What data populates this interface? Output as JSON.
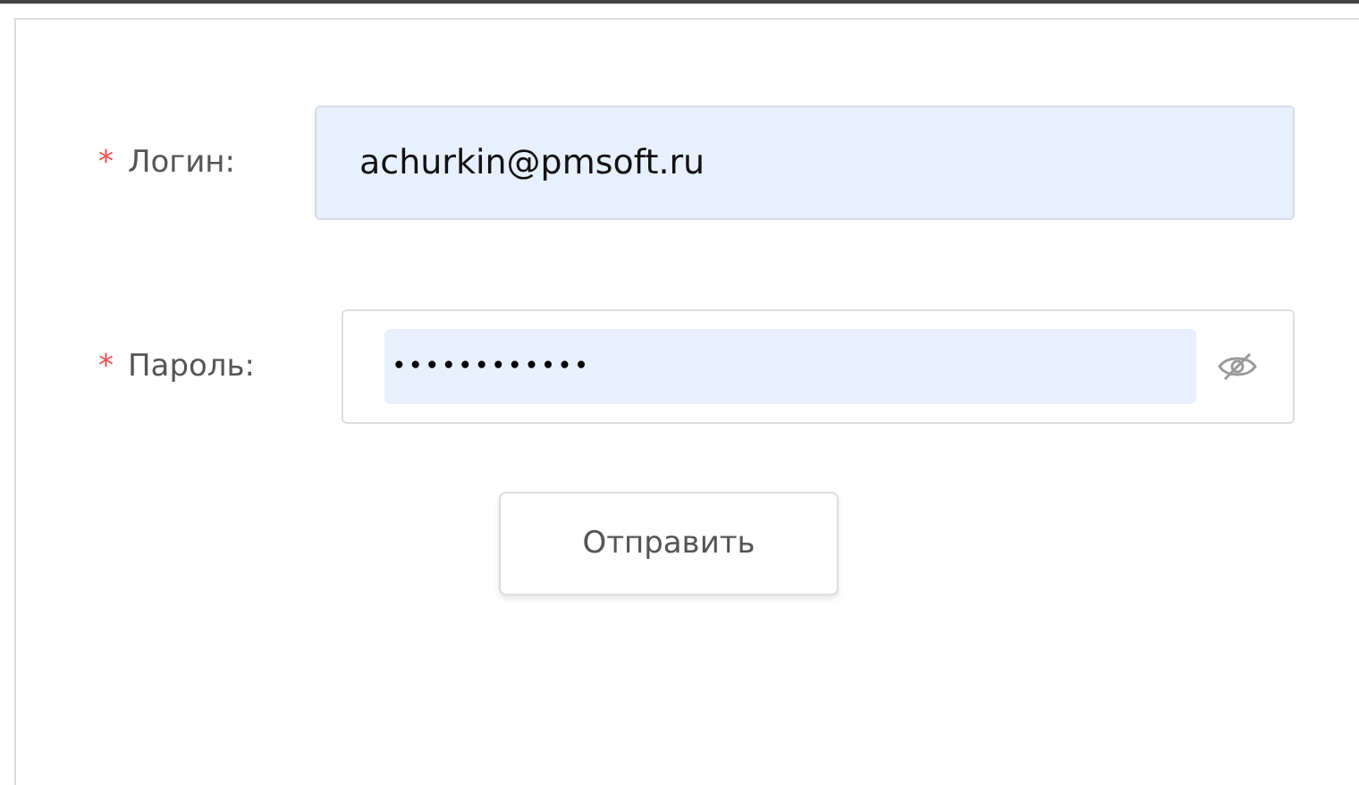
{
  "form": {
    "fields": [
      {
        "kind": "text",
        "required_mark": "*",
        "label": "Логин:",
        "value": "achurkin@pmsoft.ru"
      },
      {
        "kind": "password",
        "required_mark": "*",
        "label": "Пароль:",
        "value": "••••••••••••"
      }
    ],
    "submit": "Отправить"
  }
}
